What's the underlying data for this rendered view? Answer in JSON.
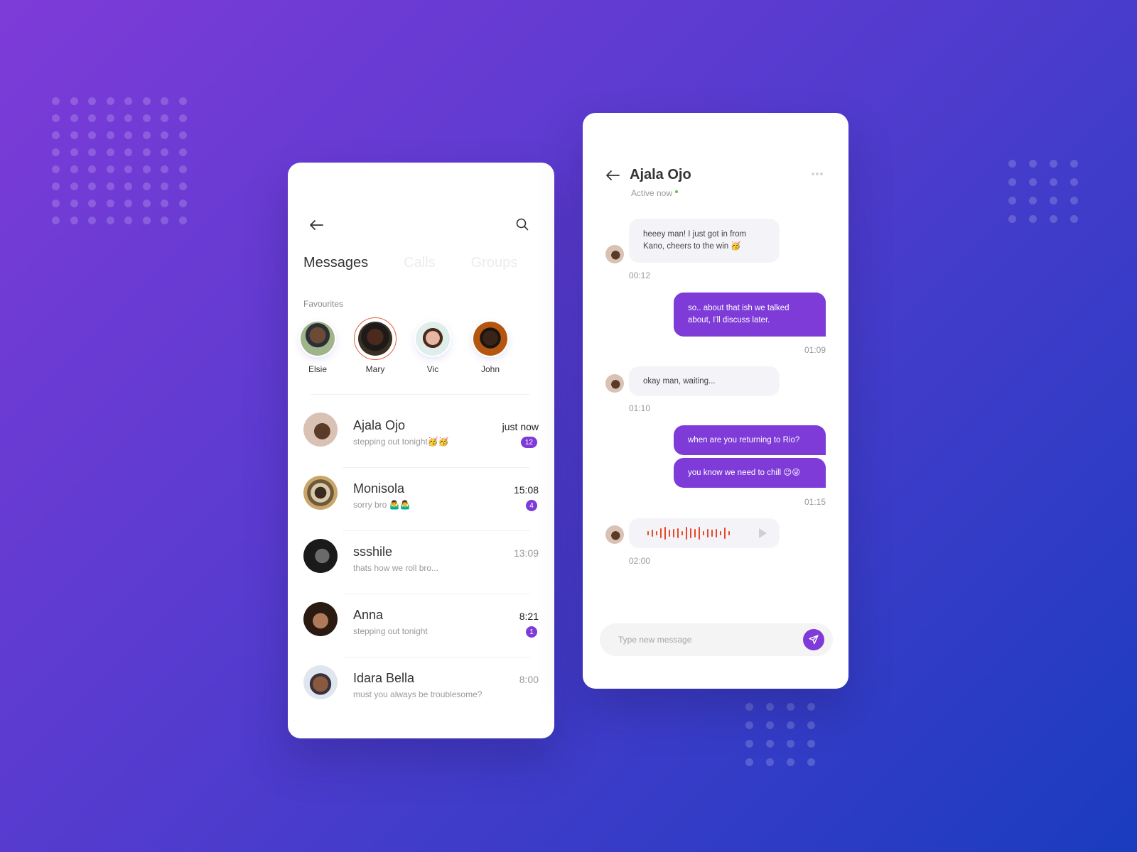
{
  "colors": {
    "accent": "#7e3bd8",
    "online": "#5cc43a",
    "selected_ring": "#e2603a",
    "waveform": "#e6492a"
  },
  "messages_screen": {
    "back_icon": "arrow-left-icon",
    "search_icon": "search-icon",
    "tabs": [
      {
        "label": "Messages",
        "active": true
      },
      {
        "label": "Calls",
        "active": false
      },
      {
        "label": "Groups",
        "active": false
      }
    ],
    "favourites_label": "Favourites",
    "favourites": [
      {
        "name": "Elsie",
        "selected": false
      },
      {
        "name": "Mary",
        "selected": true
      },
      {
        "name": "Vic",
        "selected": false
      },
      {
        "name": "John",
        "selected": false
      }
    ],
    "conversations": [
      {
        "name": "Ajala Ojo",
        "preview": "stepping out tonight🥳🥳",
        "time": "just now",
        "unread": "12",
        "time_bold": true
      },
      {
        "name": "Monisola",
        "preview": "sorry bro 🤷‍♂️🤷‍♂️",
        "time": "15:08",
        "unread": "4",
        "time_bold": true
      },
      {
        "name": "ssshile",
        "preview": "thats how we roll bro...",
        "time": "13:09",
        "unread": null,
        "time_bold": false
      },
      {
        "name": "Anna",
        "preview": "stepping out tonight",
        "time": "8:21",
        "unread": "1",
        "time_bold": true
      },
      {
        "name": "Idara Bella",
        "preview": "must you always be troublesome?",
        "time": "8:00",
        "unread": null,
        "time_bold": false
      }
    ]
  },
  "chat_screen": {
    "back_icon": "arrow-left-icon",
    "contact_name": "Ajala Ojo",
    "status": "Active now",
    "more_icon": "more-horizontal-icon",
    "messages": [
      {
        "direction": "in",
        "text": "heeey man! I just got in from Kano, cheers to the win 🥳",
        "time": "00:12"
      },
      {
        "direction": "out",
        "text": "so.. about that ish we talked about, I'll discuss  later.",
        "time": "01:09"
      },
      {
        "direction": "in",
        "text": "okay man, waiting...",
        "time": "01:10"
      },
      {
        "direction": "out",
        "text": "when are you returning to Rio?",
        "time": null
      },
      {
        "direction": "out",
        "text": "you know we need to chill  😉😜",
        "time": "01:15"
      },
      {
        "direction": "in",
        "type": "voice",
        "text": "",
        "time": "02:00"
      }
    ],
    "composer": {
      "placeholder": "Type new message",
      "value": "",
      "send_icon": "send-icon"
    }
  }
}
